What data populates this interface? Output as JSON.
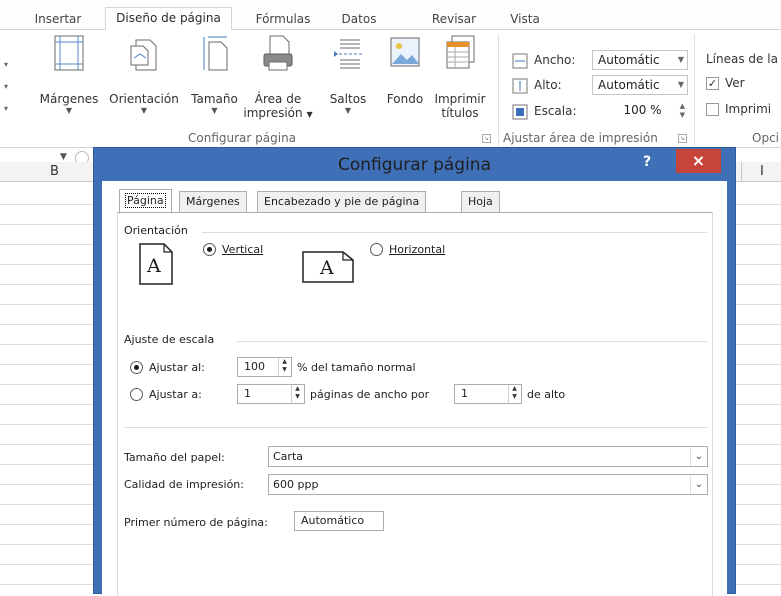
{
  "ribbon": {
    "tabs": [
      "Insertar",
      "Diseño de página",
      "Fórmulas",
      "Datos",
      "Revisar",
      "Vista"
    ],
    "active_tab": "Diseño de página",
    "page_setup_group": {
      "buttons": [
        {
          "label": "Márgenes",
          "icon": "margins-icon"
        },
        {
          "label": "Orientación",
          "icon": "orientation-icon"
        },
        {
          "label": "Tamaño",
          "icon": "size-icon"
        },
        {
          "label": "Área de",
          "label2": "impresión",
          "icon": "print-area-icon"
        },
        {
          "label": "Saltos",
          "icon": "breaks-icon"
        },
        {
          "label": "Fondo",
          "icon": "background-icon"
        },
        {
          "label": "Imprimir",
          "label2": "títulos",
          "icon": "print-titles-icon"
        }
      ],
      "group_label": "Configurar página"
    },
    "scale_to_fit_group": {
      "ancho_label": "Ancho:",
      "ancho_value": "Automátic",
      "alto_label": "Alto:",
      "alto_value": "Automátic",
      "escala_label": "Escala:",
      "escala_value": "100 %",
      "group_label": "Ajustar área de impresión"
    },
    "sheet_options_group": {
      "title": "Líneas de la",
      "ver_label": "Ver",
      "ver_checked": true,
      "imprimir_label": "Imprimi",
      "imprimir_checked": false,
      "group_label": "Opci"
    }
  },
  "sheet": {
    "columns": [
      "B",
      "I"
    ]
  },
  "dialog": {
    "title": "Configurar página",
    "help": "?",
    "close": "×",
    "tabs": [
      "Página",
      "Márgenes",
      "Encabezado y pie de página",
      "Hoja"
    ],
    "active_tab": "Página",
    "orientation": {
      "section_label": "Orientación",
      "vertical_label": "Vertical",
      "horizontal_label": "Horizontal",
      "selected": "vertical",
      "icon_letter": "A"
    },
    "scaling": {
      "section_label": "Ajuste de escala",
      "adjust_to_label": "Ajustar al:",
      "adjust_to_value": "100",
      "adjust_to_suffix": "% del tamaño normal",
      "fit_to_label": "Ajustar a:",
      "fit_wide_value": "1",
      "fit_wide_suffix": "páginas de ancho por",
      "fit_tall_value": "1",
      "fit_tall_suffix": "de alto",
      "selected": "adjust_to"
    },
    "paper_size": {
      "label": "Tamaño del papel:",
      "value": "Carta"
    },
    "print_quality": {
      "label": "Calidad de impresión:",
      "value": "600 ppp"
    },
    "first_page_number": {
      "label": "Primer número de página:",
      "value": "Automático"
    }
  }
}
